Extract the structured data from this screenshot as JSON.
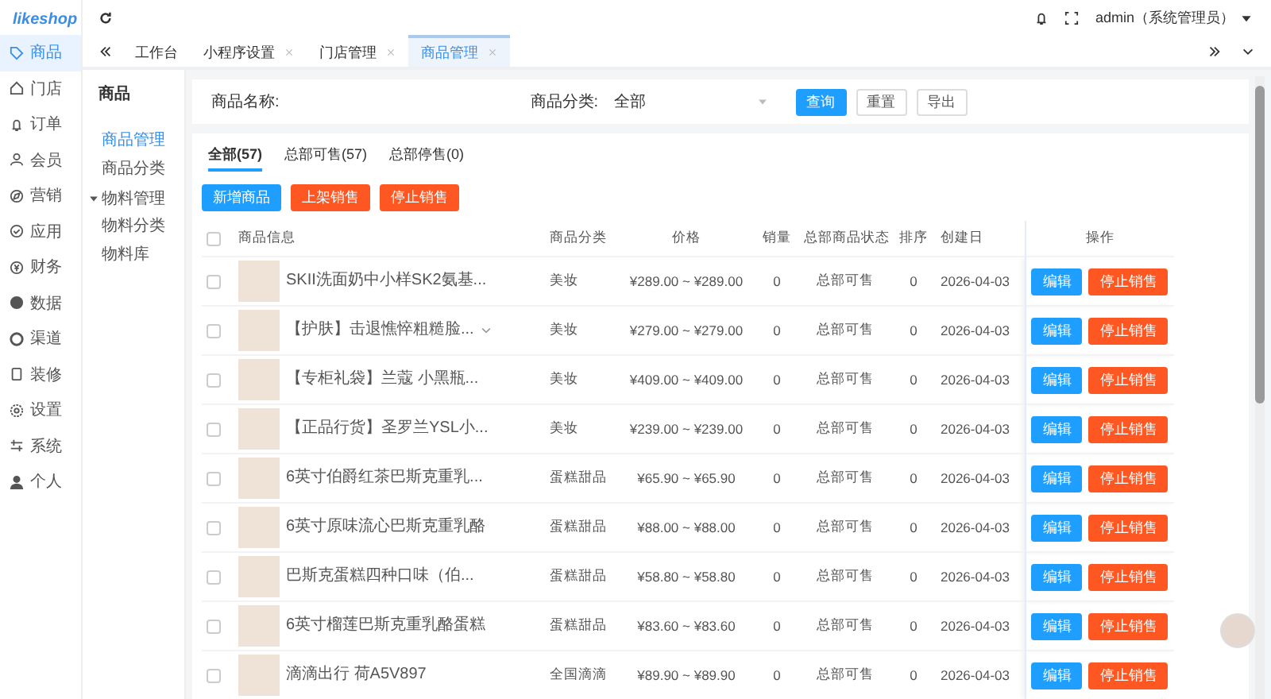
{
  "header": {
    "logo": "likeshop",
    "user": "admin（系统管理员）"
  },
  "sidebar": {
    "items": [
      {
        "label": "商品",
        "selected": true
      },
      {
        "label": "门店",
        "selected": false
      },
      {
        "label": "订单",
        "selected": false
      },
      {
        "label": "会员",
        "selected": false
      },
      {
        "label": "营销",
        "selected": false
      },
      {
        "label": "应用",
        "selected": false
      },
      {
        "label": "财务",
        "selected": false
      },
      {
        "label": "数据",
        "selected": false
      },
      {
        "label": "渠道",
        "selected": false
      },
      {
        "label": "装修",
        "selected": false
      },
      {
        "label": "设置",
        "selected": false
      },
      {
        "label": "系统",
        "selected": false
      },
      {
        "label": "个人",
        "selected": false
      }
    ]
  },
  "tabs": [
    {
      "label": "工作台",
      "selected": false,
      "closable": false
    },
    {
      "label": "小程序设置",
      "selected": false,
      "closable": true
    },
    {
      "label": "门店管理",
      "selected": false,
      "closable": true
    },
    {
      "label": "商品管理",
      "selected": true,
      "closable": true
    }
  ],
  "submenu": {
    "title": "商品",
    "items": [
      {
        "label": "商品管理",
        "selected": true
      },
      {
        "label": "商品分类",
        "selected": false
      },
      {
        "label": "物料管理",
        "selected": false,
        "expanded": true,
        "children": [
          {
            "label": "物料分类",
            "selected": false
          },
          {
            "label": "物料库",
            "selected": false
          }
        ]
      }
    ]
  },
  "filter": {
    "name_label": "商品名称:",
    "category_label": "商品分类:",
    "category_value": "全部",
    "buttons": [
      {
        "label": "查询",
        "kind": "primary"
      },
      {
        "label": "重置",
        "kind": "plain"
      },
      {
        "label": "导出",
        "kind": "plain"
      }
    ]
  },
  "status_tabs": [
    {
      "label": "全部(57)",
      "selected": true
    },
    {
      "label": "总部可售(57)",
      "selected": false
    },
    {
      "label": "总部停售(0)",
      "selected": false
    }
  ],
  "actions": [
    {
      "label": "新增商品",
      "kind": "primary"
    },
    {
      "label": "上架销售",
      "kind": "danger"
    },
    {
      "label": "停止销售",
      "kind": "danger"
    }
  ],
  "table": {
    "columns": [
      "商品信息",
      "商品分类",
      "价格",
      "销量",
      "总部商品状态",
      "排序",
      "创建日",
      "操作"
    ],
    "header_checked": false,
    "rows": [
      {
        "checked": false,
        "name": "SKII洗面奶中小样SK2氨基...",
        "expandable": false,
        "category": "美妆",
        "price": "¥289.00 ~ ¥289.00",
        "sales": "0",
        "status": "总部可售",
        "sort": "0",
        "created": "2026-04-03",
        "buttons": [
          "编辑",
          "停止销售"
        ]
      },
      {
        "checked": false,
        "name": "【护肤】击退憔悴粗糙脸...",
        "expandable": true,
        "category": "美妆",
        "price": "¥279.00 ~ ¥279.00",
        "sales": "0",
        "status": "总部可售",
        "sort": "0",
        "created": "2026-04-03",
        "buttons": [
          "编辑",
          "停止销售"
        ]
      },
      {
        "checked": false,
        "name": "【专柜礼袋】兰蔻 小黑瓶...",
        "expandable": false,
        "category": "美妆",
        "price": "¥409.00 ~ ¥409.00",
        "sales": "0",
        "status": "总部可售",
        "sort": "0",
        "created": "2026-04-03",
        "buttons": [
          "编辑",
          "停止销售"
        ]
      },
      {
        "checked": false,
        "name": "【正品行货】圣罗兰YSL小...",
        "expandable": false,
        "category": "美妆",
        "price": "¥239.00 ~ ¥239.00",
        "sales": "0",
        "status": "总部可售",
        "sort": "0",
        "created": "2026-04-03",
        "buttons": [
          "编辑",
          "停止销售"
        ]
      },
      {
        "checked": false,
        "name": "6英寸伯爵红茶巴斯克重乳...",
        "expandable": false,
        "category": "蛋糕甜品",
        "price": "¥65.90 ~ ¥65.90",
        "sales": "0",
        "status": "总部可售",
        "sort": "0",
        "created": "2026-04-03",
        "buttons": [
          "编辑",
          "停止销售"
        ]
      },
      {
        "checked": false,
        "name": "6英寸原味流心巴斯克重乳酪",
        "expandable": false,
        "category": "蛋糕甜品",
        "price": "¥88.00 ~ ¥88.00",
        "sales": "0",
        "status": "总部可售",
        "sort": "0",
        "created": "2026-04-03",
        "buttons": [
          "编辑",
          "停止销售"
        ]
      },
      {
        "checked": false,
        "name": "巴斯克蛋糕四种口味（伯...",
        "expandable": false,
        "category": "蛋糕甜品",
        "price": "¥58.80 ~ ¥58.80",
        "sales": "0",
        "status": "总部可售",
        "sort": "0",
        "created": "2026-04-03",
        "buttons": [
          "编辑",
          "停止销售"
        ]
      },
      {
        "checked": false,
        "name": "6英寸榴莲巴斯克重乳酪蛋糕",
        "expandable": false,
        "category": "蛋糕甜品",
        "price": "¥83.60 ~ ¥83.60",
        "sales": "0",
        "status": "总部可售",
        "sort": "0",
        "created": "2026-04-03",
        "buttons": [
          "编辑",
          "停止销售"
        ]
      },
      {
        "checked": false,
        "name": "滴滴出行 荷A5V897",
        "expandable": false,
        "category": "全国滴滴",
        "price": "¥89.90 ~ ¥89.90",
        "sales": "0",
        "status": "总部可售",
        "sort": "0",
        "created": "2026-04-03",
        "buttons": [
          "编辑",
          "停止销售"
        ]
      }
    ]
  }
}
